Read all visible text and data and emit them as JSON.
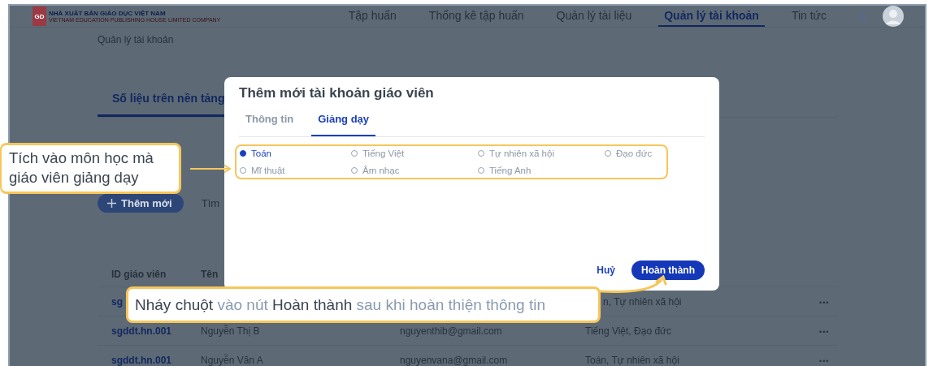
{
  "header": {
    "logo": {
      "mark": "GD",
      "title": "NHÀ XUẤT BẢN GIÁO DỤC VIỆT NAM",
      "subtitle": "VIETNAM EDUCATION PUBLISHING HOUSE LIMITED COMPANY"
    },
    "nav": [
      {
        "label": "Tập huấn",
        "selected": false
      },
      {
        "label": "Thống kê tập huấn",
        "selected": false
      },
      {
        "label": "Quản lý tài liệu",
        "selected": false
      },
      {
        "label": "Quản lý tài khoản",
        "selected": true
      },
      {
        "label": "Tin tức",
        "selected": false
      }
    ]
  },
  "breadcrumb": "Quản lý tài khoản",
  "section_tabs": [
    {
      "label": "Số liệu trên nền tảng",
      "selected": true
    }
  ],
  "toolbar": {
    "add_button": "Thêm mới",
    "search_label": "Tìm"
  },
  "table": {
    "columns": [
      "ID giáo viên",
      "Tên"
    ],
    "rows": [
      {
        "id": "sg",
        "name": "",
        "email": "",
        "subjects": "n, Tự nhiên xã hội",
        "actions": "•••"
      },
      {
        "id": "sgddt.hn.001",
        "name": "Nguyễn Thị B",
        "email": "nguyenthib@gmail.com",
        "subjects": "Tiếng Việt, Đạo đức",
        "actions": "•••"
      },
      {
        "id": "sgddt.hn.001",
        "name": "Nguyễn Văn A",
        "email": "nguyenvana@gmail.com",
        "subjects": "Toán, Tự nhiên xã hội",
        "actions": "•••"
      }
    ]
  },
  "modal": {
    "title": "Thêm mới tài khoản giáo viên",
    "tabs": [
      {
        "label": "Thông tin",
        "selected": false
      },
      {
        "label": "Giảng dạy",
        "selected": true
      }
    ],
    "subjects": [
      {
        "label": "Toán",
        "selected": true
      },
      {
        "label": "Tiếng Việt",
        "selected": false
      },
      {
        "label": "Tự nhiên xã hội",
        "selected": false
      },
      {
        "label": "Đạo đức",
        "selected": false
      },
      {
        "label": "Mĩ thuật",
        "selected": false
      },
      {
        "label": "Âm nhạc",
        "selected": false
      },
      {
        "label": "Tiếng Anh",
        "selected": false
      }
    ],
    "buttons": [
      {
        "label": "Huỷ",
        "kind": "text"
      },
      {
        "label": "Hoàn thành",
        "kind": "primary"
      }
    ]
  },
  "callouts": [
    {
      "kind": "plain",
      "text": "Tích vào môn học mà giáo viên giảng dạy"
    },
    {
      "kind": "mixed",
      "segments": [
        {
          "text": "Nháy chuột",
          "emphasis": true
        },
        {
          "text": "vào nút",
          "emphasis": false
        },
        {
          "text": "Hoàn thành",
          "emphasis": true
        },
        {
          "text": "sau khi hoàn thiện thông tin",
          "emphasis": false
        }
      ]
    }
  ]
}
